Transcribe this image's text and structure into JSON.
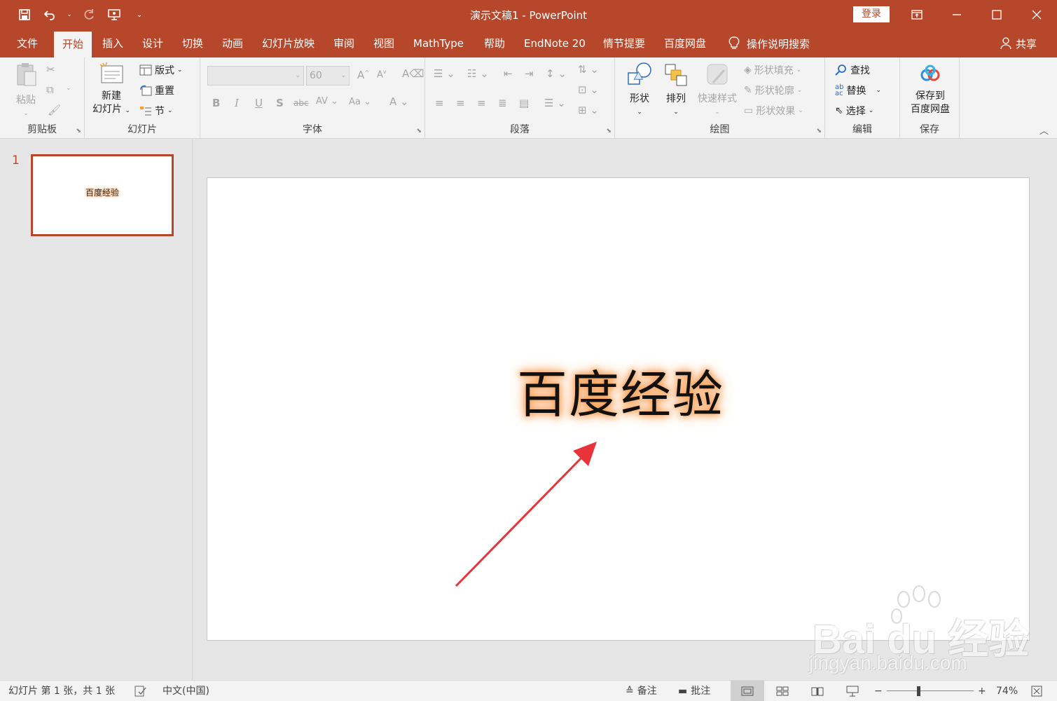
{
  "window": {
    "title": "演示文稿1  -  PowerPoint",
    "login": "登录"
  },
  "qat": {
    "save": "save-icon",
    "undo": "undo-icon",
    "redo": "redo-icon",
    "present": "present-icon",
    "customize": "customize-icon"
  },
  "tabs": [
    "文件",
    "开始",
    "插入",
    "设计",
    "切换",
    "动画",
    "幻灯片放映",
    "审阅",
    "视图",
    "MathType",
    "帮助",
    "EndNote 20",
    "情节提要",
    "百度网盘"
  ],
  "active_tab": "开始",
  "tell_me": "操作说明搜索",
  "share": "共享",
  "ribbon": {
    "clipboard": {
      "label": "剪贴板",
      "paste": "粘贴"
    },
    "slides": {
      "label": "幻灯片",
      "new_slide_1": "新建",
      "new_slide_2": "幻灯片",
      "layout": "版式",
      "reset": "重置",
      "section": "节"
    },
    "font": {
      "label": "字体",
      "font_name": "",
      "font_size": "60"
    },
    "paragraph": {
      "label": "段落"
    },
    "drawing": {
      "label": "绘图",
      "shapes": "形状",
      "arrange": "排列",
      "quick_styles": "快速样式",
      "shape_fill": "形状填充",
      "shape_outline": "形状轮廓",
      "shape_effects": "形状效果"
    },
    "editing": {
      "label": "编辑",
      "find": "查找",
      "replace": "替换",
      "select": "选择"
    },
    "save": {
      "label": "保存",
      "save_to_1": "保存到",
      "save_to_2": "百度网盘"
    }
  },
  "slides_pane": {
    "slide_number": "1",
    "thumb_text": "百度经验"
  },
  "slide": {
    "title": "百度经验"
  },
  "watermark": {
    "logo": "Bai du 经验",
    "url": "jingyan.baidu.com"
  },
  "status": {
    "slide_info": "幻灯片 第 1 张，共 1 张",
    "language": "中文(中国)",
    "notes": "备注",
    "comments": "批注",
    "zoom": "74%"
  },
  "colors": {
    "accent": "#b7472a",
    "glow": "#f79a4c",
    "arrow": "#e8333a"
  }
}
